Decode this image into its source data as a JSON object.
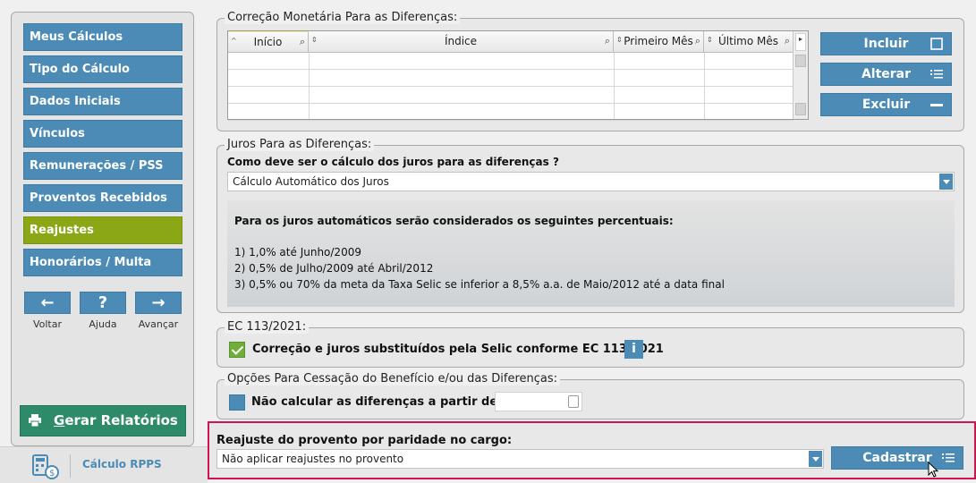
{
  "sidebar": {
    "items": [
      {
        "label": "Meus Cálculos"
      },
      {
        "label": "Tipo do Cálculo"
      },
      {
        "label": "Dados Iniciais"
      },
      {
        "label": "Vínculos"
      },
      {
        "label": "Remunerações / PSS"
      },
      {
        "label": "Proventos Recebidos"
      },
      {
        "label": "Reajustes",
        "active": true
      },
      {
        "label": "Honorários / Multa"
      }
    ],
    "nav": {
      "back_glyph": "←",
      "back_label": "Voltar",
      "help_glyph": "?",
      "help_label": "Ajuda",
      "forward_glyph": "→",
      "forward_label": "Avançar"
    },
    "report_button": "Gerar Relatórios",
    "brand": "Cálculo RPPS"
  },
  "correcao": {
    "legend": "Correção Monetária Para as Diferenças:",
    "columns": [
      "Início",
      "Índice",
      "Primeiro Mês",
      "Último Mês"
    ],
    "rows": [
      [
        "",
        "",
        "",
        ""
      ],
      [
        "",
        "",
        "",
        ""
      ],
      [
        "",
        "",
        "",
        ""
      ],
      [
        "",
        "",
        "",
        ""
      ]
    ],
    "buttons": {
      "include": "Incluir",
      "alter": "Alterar",
      "delete": "Excluir"
    }
  },
  "juros": {
    "legend": "Juros Para as Diferenças:",
    "question": "Como deve ser o cálculo dos juros para as diferenças ?",
    "selected": "Cálculo Automático dos Juros",
    "info_heading": "Para os juros automáticos serão considerados os seguintes percentuais:",
    "info_lines": [
      "1) 1,0% até Junho/2009",
      "2) 0,5% de Julho/2009 até Abril/2012",
      "3) 0,5% ou 70% da meta da Taxa Selic se inferior a 8,5% a.a. de Maio/2012 até a data final"
    ]
  },
  "ec": {
    "legend": "EC 113/2021:",
    "checkbox_label": "Correção e juros substituídos pela Selic conforme EC 113/2021",
    "checked": true,
    "info_glyph": "i"
  },
  "cessacao": {
    "legend": "Opções Para Cessação do Benefício e/ou das Diferenças:",
    "checkbox_label": "Não calcular as diferenças a partir de",
    "checked": false,
    "date_value": ""
  },
  "reajuste": {
    "label": "Reajuste do provento por paridade no cargo:",
    "selected": "Não aplicar reajustes no provento",
    "submit": "Cadastrar"
  },
  "colors": {
    "accent": "#4c8bb5",
    "active": "#8ba716",
    "report": "#2e8b6a",
    "highlight_border": "#d1134e"
  }
}
